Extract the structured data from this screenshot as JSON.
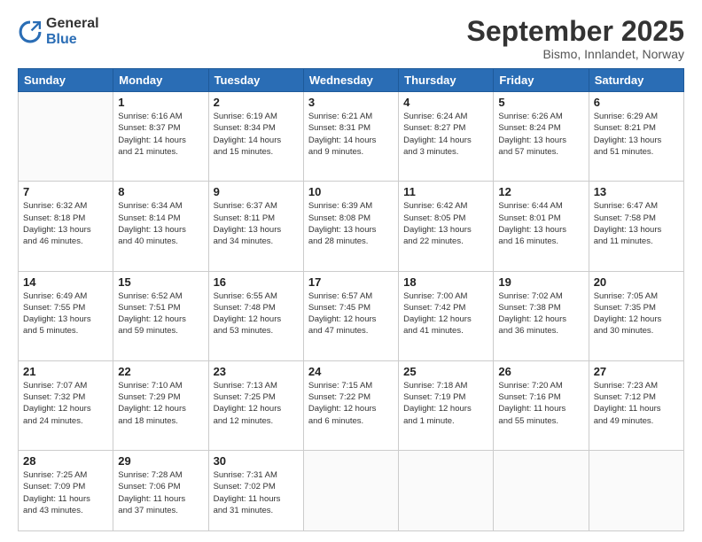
{
  "header": {
    "logo_general": "General",
    "logo_blue": "Blue",
    "month_title": "September 2025",
    "location": "Bismo, Innlandet, Norway"
  },
  "days_of_week": [
    "Sunday",
    "Monday",
    "Tuesday",
    "Wednesday",
    "Thursday",
    "Friday",
    "Saturday"
  ],
  "weeks": [
    [
      {
        "day": "",
        "info": ""
      },
      {
        "day": "1",
        "info": "Sunrise: 6:16 AM\nSunset: 8:37 PM\nDaylight: 14 hours\nand 21 minutes."
      },
      {
        "day": "2",
        "info": "Sunrise: 6:19 AM\nSunset: 8:34 PM\nDaylight: 14 hours\nand 15 minutes."
      },
      {
        "day": "3",
        "info": "Sunrise: 6:21 AM\nSunset: 8:31 PM\nDaylight: 14 hours\nand 9 minutes."
      },
      {
        "day": "4",
        "info": "Sunrise: 6:24 AM\nSunset: 8:27 PM\nDaylight: 14 hours\nand 3 minutes."
      },
      {
        "day": "5",
        "info": "Sunrise: 6:26 AM\nSunset: 8:24 PM\nDaylight: 13 hours\nand 57 minutes."
      },
      {
        "day": "6",
        "info": "Sunrise: 6:29 AM\nSunset: 8:21 PM\nDaylight: 13 hours\nand 51 minutes."
      }
    ],
    [
      {
        "day": "7",
        "info": "Sunrise: 6:32 AM\nSunset: 8:18 PM\nDaylight: 13 hours\nand 46 minutes."
      },
      {
        "day": "8",
        "info": "Sunrise: 6:34 AM\nSunset: 8:14 PM\nDaylight: 13 hours\nand 40 minutes."
      },
      {
        "day": "9",
        "info": "Sunrise: 6:37 AM\nSunset: 8:11 PM\nDaylight: 13 hours\nand 34 minutes."
      },
      {
        "day": "10",
        "info": "Sunrise: 6:39 AM\nSunset: 8:08 PM\nDaylight: 13 hours\nand 28 minutes."
      },
      {
        "day": "11",
        "info": "Sunrise: 6:42 AM\nSunset: 8:05 PM\nDaylight: 13 hours\nand 22 minutes."
      },
      {
        "day": "12",
        "info": "Sunrise: 6:44 AM\nSunset: 8:01 PM\nDaylight: 13 hours\nand 16 minutes."
      },
      {
        "day": "13",
        "info": "Sunrise: 6:47 AM\nSunset: 7:58 PM\nDaylight: 13 hours\nand 11 minutes."
      }
    ],
    [
      {
        "day": "14",
        "info": "Sunrise: 6:49 AM\nSunset: 7:55 PM\nDaylight: 13 hours\nand 5 minutes."
      },
      {
        "day": "15",
        "info": "Sunrise: 6:52 AM\nSunset: 7:51 PM\nDaylight: 12 hours\nand 59 minutes."
      },
      {
        "day": "16",
        "info": "Sunrise: 6:55 AM\nSunset: 7:48 PM\nDaylight: 12 hours\nand 53 minutes."
      },
      {
        "day": "17",
        "info": "Sunrise: 6:57 AM\nSunset: 7:45 PM\nDaylight: 12 hours\nand 47 minutes."
      },
      {
        "day": "18",
        "info": "Sunrise: 7:00 AM\nSunset: 7:42 PM\nDaylight: 12 hours\nand 41 minutes."
      },
      {
        "day": "19",
        "info": "Sunrise: 7:02 AM\nSunset: 7:38 PM\nDaylight: 12 hours\nand 36 minutes."
      },
      {
        "day": "20",
        "info": "Sunrise: 7:05 AM\nSunset: 7:35 PM\nDaylight: 12 hours\nand 30 minutes."
      }
    ],
    [
      {
        "day": "21",
        "info": "Sunrise: 7:07 AM\nSunset: 7:32 PM\nDaylight: 12 hours\nand 24 minutes."
      },
      {
        "day": "22",
        "info": "Sunrise: 7:10 AM\nSunset: 7:29 PM\nDaylight: 12 hours\nand 18 minutes."
      },
      {
        "day": "23",
        "info": "Sunrise: 7:13 AM\nSunset: 7:25 PM\nDaylight: 12 hours\nand 12 minutes."
      },
      {
        "day": "24",
        "info": "Sunrise: 7:15 AM\nSunset: 7:22 PM\nDaylight: 12 hours\nand 6 minutes."
      },
      {
        "day": "25",
        "info": "Sunrise: 7:18 AM\nSunset: 7:19 PM\nDaylight: 12 hours\nand 1 minute."
      },
      {
        "day": "26",
        "info": "Sunrise: 7:20 AM\nSunset: 7:16 PM\nDaylight: 11 hours\nand 55 minutes."
      },
      {
        "day": "27",
        "info": "Sunrise: 7:23 AM\nSunset: 7:12 PM\nDaylight: 11 hours\nand 49 minutes."
      }
    ],
    [
      {
        "day": "28",
        "info": "Sunrise: 7:25 AM\nSunset: 7:09 PM\nDaylight: 11 hours\nand 43 minutes."
      },
      {
        "day": "29",
        "info": "Sunrise: 7:28 AM\nSunset: 7:06 PM\nDaylight: 11 hours\nand 37 minutes."
      },
      {
        "day": "30",
        "info": "Sunrise: 7:31 AM\nSunset: 7:02 PM\nDaylight: 11 hours\nand 31 minutes."
      },
      {
        "day": "",
        "info": ""
      },
      {
        "day": "",
        "info": ""
      },
      {
        "day": "",
        "info": ""
      },
      {
        "day": "",
        "info": ""
      }
    ]
  ]
}
